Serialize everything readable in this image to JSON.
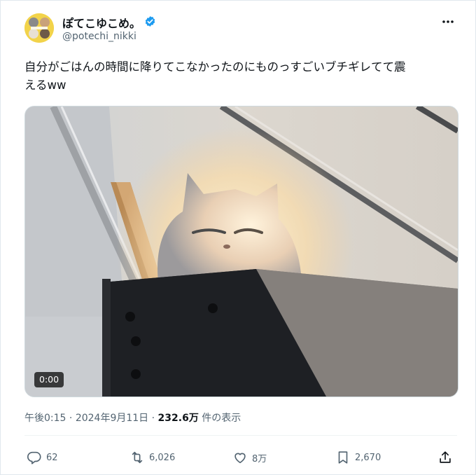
{
  "author": {
    "display_name": "ぽてこゆこめ。",
    "handle": "@potechi_nikki",
    "verified_icon": "verified-badge-icon",
    "avatar_color": "#f2d34a"
  },
  "tweet": {
    "text_line1": "自分がごはんの時間に降りてこなかったのにものっすごいブチギレてて震",
    "text_line2": "えるww"
  },
  "media": {
    "type": "video",
    "timestamp": "0:00"
  },
  "meta": {
    "time": "午後0:15",
    "separator": " · ",
    "date": "2024年9月11日",
    "views_count": "232.6万",
    "views_label": "件の表示"
  },
  "actions": {
    "reply": {
      "icon": "reply-icon",
      "count": "62"
    },
    "retweet": {
      "icon": "retweet-icon",
      "count": "6,026"
    },
    "like": {
      "icon": "heart-icon",
      "count": "8万"
    },
    "bookmark": {
      "icon": "bookmark-icon",
      "count": "2,670"
    },
    "share": {
      "icon": "share-icon"
    }
  },
  "colors": {
    "text_primary": "#0f1419",
    "text_secondary": "#536471",
    "verified_blue": "#1d9bf0",
    "border": "#cfd9de"
  }
}
